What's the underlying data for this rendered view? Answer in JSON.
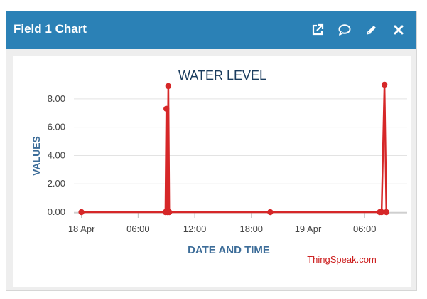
{
  "header": {
    "title": "Field 1 Chart",
    "bg_color": "#2b81b6",
    "tools": [
      {
        "name": "open-in-new-window-icon"
      },
      {
        "name": "comment-icon"
      },
      {
        "name": "edit-pencil-icon"
      },
      {
        "name": "close-icon"
      }
    ]
  },
  "credit": {
    "text": "ThingSpeak.com",
    "color": "#cc1f1f"
  },
  "chart_data": {
    "type": "line",
    "title": "WATER LEVEL",
    "xlabel": "DATE AND TIME",
    "ylabel": "VALUES",
    "ylim": [
      0,
      9
    ],
    "yticks": [
      0,
      2,
      4,
      6,
      8
    ],
    "ytick_labels": [
      "0.00",
      "2.00",
      "4.00",
      "6.00",
      "8.00"
    ],
    "xticks": [
      {
        "t": 0,
        "label": "18 Apr"
      },
      {
        "t": 6,
        "label": "06:00"
      },
      {
        "t": 12,
        "label": "12:00"
      },
      {
        "t": 18,
        "label": "18:00"
      },
      {
        "t": 24,
        "label": "19 Apr"
      },
      {
        "t": 30,
        "label": "06:00"
      }
    ],
    "xlim": [
      -0.8,
      34.5
    ],
    "grid": true,
    "series_color": "#d62728",
    "points": [
      {
        "t": 0.0,
        "v": 0
      },
      {
        "t": 8.9,
        "v": 0
      },
      {
        "t": 9.0,
        "v": 7.3
      },
      {
        "t": 9.1,
        "v": 0
      },
      {
        "t": 9.2,
        "v": 8.9
      },
      {
        "t": 9.3,
        "v": 0
      },
      {
        "t": 20.0,
        "v": 0
      },
      {
        "t": 31.6,
        "v": 0
      },
      {
        "t": 31.8,
        "v": 0
      },
      {
        "t": 32.1,
        "v": 9.0
      },
      {
        "t": 32.3,
        "v": 0
      }
    ]
  }
}
